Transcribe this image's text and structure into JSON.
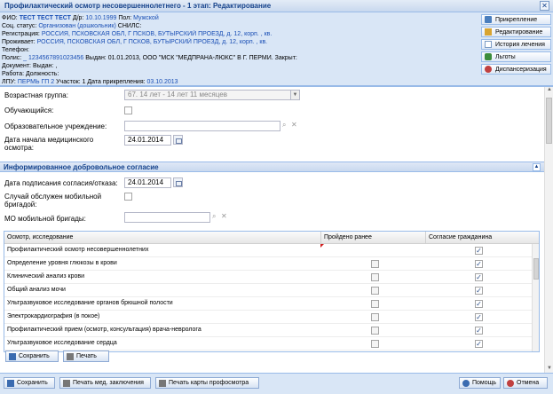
{
  "window": {
    "title": "Профилактический осмотр несовершеннолетнего - 1 этап: Редактирование"
  },
  "patient": {
    "fio_label": "ФИО:",
    "fio": "ТЕСТ ТЕСТ ТЕСТ",
    "dob_label": "Д/р:",
    "dob": "10.10.1999",
    "sex_label": "Пол:",
    "sex": "Мужской",
    "soc_label": "Соц. статус:",
    "soc": "Организован (дошкольник)",
    "snils_label": "СНИЛС:",
    "reg_label": "Регистрация:",
    "reg": "РОССИЯ, ПСКОВСКАЯ ОБЛ, Г ПСКОВ, БУТЫРСКИЙ ПРОЕЗД, д. 12, корп. , кв.",
    "live_label": "Проживает:",
    "live": "РОССИЯ, ПСКОВСКАЯ ОБЛ, Г ПСКОВ, БУТЫРСКИЙ ПРОЕЗД, д. 12, корп. , кв.",
    "phone_label": "Телефон:",
    "polis_label": "Полис:",
    "polis": "_ 1234567891023456",
    "polis_rest": "Выдан: 01.01.2013, ООО \"МСК \"МЕДПРАНА-ЛЮКС\" В Г. ПЕРМИ. Закрыт:",
    "doc_label": "Документ: Выдан: ,",
    "work_label": "Работа: Должность:",
    "lpu_label": "ЛПУ:",
    "lpu": "ПЕРМЬ ГП 2",
    "lpu_mid": "Участок: 1 Дата прикрепления:",
    "lpu_date": "03.10.2013"
  },
  "side_buttons": [
    {
      "label": "Прикрепление",
      "icon": "attach-icon",
      "color": "#4a7ebd"
    },
    {
      "label": "Редактирование",
      "icon": "edit-icon",
      "color": "#d8a431"
    },
    {
      "label": "История лечения",
      "icon": "history-icon",
      "color": "#7b9bc4"
    },
    {
      "label": "Льготы",
      "icon": "benefits-icon",
      "color": "#3c8c3c"
    },
    {
      "label": "Диспансеризация",
      "icon": "dispensary-icon",
      "color": "#c04040"
    }
  ],
  "form": {
    "age_group_label": "Возрастная группа:",
    "age_group_value": "67. 14 лет - 14 лет 11 месяцев",
    "student_label": "Обучающийся:",
    "edu_label": "Образовательное учреждение:",
    "start_date_label1": "Дата начала медицинского",
    "start_date_label2": "осмотра:",
    "start_date": "24.01.2014"
  },
  "section": {
    "title": "Информированное добровольное согласие",
    "consent_date_label": "Дата подписания согласия/отказа:",
    "consent_date": "24.01.2014",
    "mobile_label1": "Случай обслужен мобильной",
    "mobile_label2": "бригадой:",
    "mo_label": "МО мобильной бригады:"
  },
  "grid": {
    "columns": [
      "Осмотр, исследование",
      "Пройдено ранее",
      "Согласие гражданина"
    ],
    "rows": [
      {
        "name": "Профилактический осмотр несовершеннолетних",
        "done": false,
        "consent": true,
        "show_done": false
      },
      {
        "name": "Определение уровня глюкозы в крови",
        "done": false,
        "consent": true,
        "show_done": true
      },
      {
        "name": "Клинический анализ крови",
        "done": false,
        "consent": true,
        "show_done": true
      },
      {
        "name": "Общий анализ мочи",
        "done": false,
        "consent": true,
        "show_done": true
      },
      {
        "name": "Ультразвуковое исследование органов брюшной полости",
        "done": false,
        "consent": true,
        "show_done": true
      },
      {
        "name": "Электрокардиография (в покое)",
        "done": false,
        "consent": true,
        "show_done": true
      },
      {
        "name": "Профилактический прием (осмотр, консультация) врача-невролога",
        "done": false,
        "consent": true,
        "show_done": true
      },
      {
        "name": "Ультразвуковое исследование сердца",
        "done": false,
        "consent": true,
        "show_done": true
      }
    ],
    "check_mark": "✓"
  },
  "body_buttons": {
    "save": "Сохранить",
    "print": "Печать"
  },
  "footer": {
    "save": "Сохранить",
    "print_med": "Печать мед. заключения",
    "print_card": "Печать карты профосмотра",
    "help": "Помощь",
    "cancel": "Отмена"
  }
}
